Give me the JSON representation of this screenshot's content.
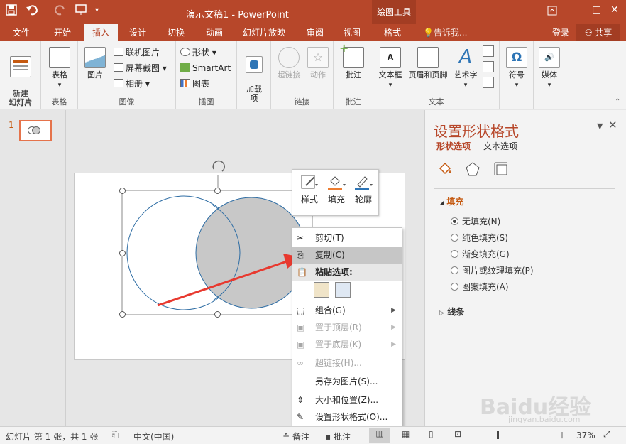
{
  "window": {
    "title": "演示文稿1 - PowerPoint",
    "context_tool": "绘图工具",
    "restore_icon": "ribbon-display-icon",
    "minimize": "－",
    "maximize": "□",
    "close": "✕"
  },
  "tabs": [
    "文件",
    "开始",
    "插入",
    "设计",
    "切换",
    "动画",
    "幻灯片放映",
    "审阅",
    "视图",
    "格式"
  ],
  "active_tab": "插入",
  "tell_me": "告诉我...",
  "signin": "登录",
  "share": "共享",
  "ribbon": {
    "slides": {
      "new_slide": "新建\n幻灯片",
      "group": "幻灯片"
    },
    "tables": {
      "table": "表格",
      "group": "表格"
    },
    "images": {
      "picture": "图片",
      "online_picture": "联机图片",
      "screenshot": "屏幕截图",
      "album": "相册",
      "group": "图像"
    },
    "illustrations": {
      "shapes": "形状",
      "smartart": "SmartArt",
      "chart": "图表",
      "group": "插图"
    },
    "addins": {
      "addins": "加载\n项",
      "group": ""
    },
    "links": {
      "hyperlink": "超链接",
      "action": "动作",
      "group": "链接"
    },
    "comments": {
      "comment": "批注",
      "group": "批注"
    },
    "text": {
      "textbox": "文本框",
      "header_footer": "页眉和页脚",
      "wordart": "艺术字",
      "group": "文本"
    },
    "symbols": {
      "symbol": "符号",
      "group": ""
    },
    "media": {
      "media": "媒体",
      "group": ""
    }
  },
  "thumbnail": {
    "number": "1"
  },
  "mini_toolbar": {
    "style": "样式",
    "fill": "填充",
    "outline": "轮廓"
  },
  "context_menu": [
    {
      "label": "剪切(T)",
      "icon": "scissors-icon",
      "enabled": true
    },
    {
      "label": "复制(C)",
      "icon": "copy-icon",
      "enabled": true,
      "highlighted": true
    },
    {
      "label": "粘贴选项:",
      "icon": "paste-icon",
      "enabled": true,
      "header": true
    },
    {
      "label": "组合(G)",
      "icon": "group-icon",
      "enabled": true,
      "submenu": true
    },
    {
      "label": "置于顶层(R)",
      "icon": "bring-front-icon",
      "enabled": false,
      "submenu": true
    },
    {
      "label": "置于底层(K)",
      "icon": "send-back-icon",
      "enabled": false,
      "submenu": true
    },
    {
      "label": "超链接(H)...",
      "icon": "hyperlink-icon",
      "enabled": false
    },
    {
      "label": "另存为图片(S)...",
      "icon": "",
      "enabled": true
    },
    {
      "label": "大小和位置(Z)...",
      "icon": "size-position-icon",
      "enabled": true
    },
    {
      "label": "设置形状格式(O)...",
      "icon": "format-shape-icon",
      "enabled": true
    }
  ],
  "format_pane": {
    "title": "设置形状格式",
    "tab_shape": "形状选项",
    "tab_text": "文本选项",
    "fill_section": "填充",
    "fill_options": [
      "无填充(N)",
      "纯色填充(S)",
      "渐变填充(G)",
      "图片或纹理填充(P)",
      "图案填充(A)"
    ],
    "selected_fill": "无填充(N)",
    "line_section": "线条"
  },
  "status": {
    "slide_info": "幻灯片 第 1 张，共 1 张",
    "language": "中文(中国)",
    "notes": "备注",
    "comments": "批注",
    "zoom": "37%"
  },
  "watermark": {
    "brand": "Baidu经验",
    "url": "jingyan.baidu.com"
  },
  "colors": {
    "accent": "#b7472a",
    "shape_fill": "#c8c8c8",
    "shape_stroke": "#2e6da4",
    "arrow": "#e8392f"
  }
}
